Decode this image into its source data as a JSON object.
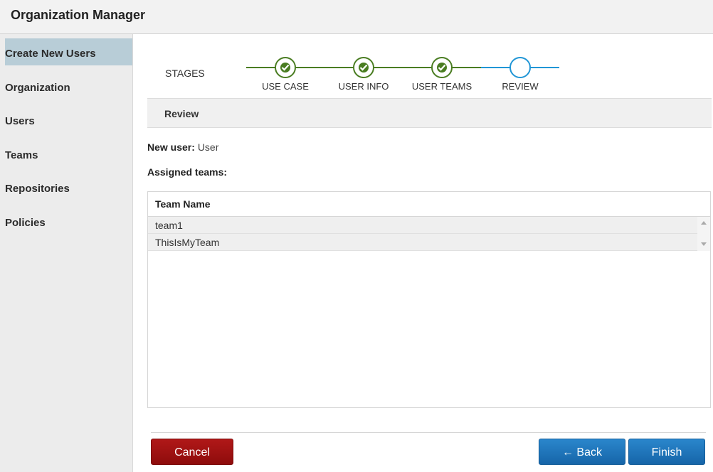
{
  "app": {
    "title": "Organization Manager"
  },
  "sidebar": {
    "items": [
      {
        "label": "Create New Users",
        "active": true
      },
      {
        "label": "Organization",
        "active": false
      },
      {
        "label": "Users",
        "active": false
      },
      {
        "label": "Teams",
        "active": false
      },
      {
        "label": "Repositories",
        "active": false
      },
      {
        "label": "Policies",
        "active": false
      }
    ]
  },
  "stages": {
    "label": "STAGES",
    "steps": [
      {
        "label": "USE CASE",
        "status": "complete"
      },
      {
        "label": "USER INFO",
        "status": "complete"
      },
      {
        "label": "USER TEAMS",
        "status": "complete"
      },
      {
        "label": "REVIEW",
        "status": "current"
      }
    ]
  },
  "review": {
    "section_title": "Review",
    "new_user_label": "New user:",
    "new_user_value": "User",
    "assigned_teams_label": "Assigned teams:"
  },
  "teams_table": {
    "header": "Team Name",
    "rows": [
      "team1",
      "ThisIsMyTeam"
    ]
  },
  "buttons": {
    "cancel": "Cancel",
    "back": "← Back",
    "finish": "Finish"
  },
  "colors": {
    "complete": "#4a7d22",
    "current": "#2196d6",
    "cancel": "#9e1010",
    "primary": "#1d74bb",
    "active_nav": "#b8cdd7"
  }
}
